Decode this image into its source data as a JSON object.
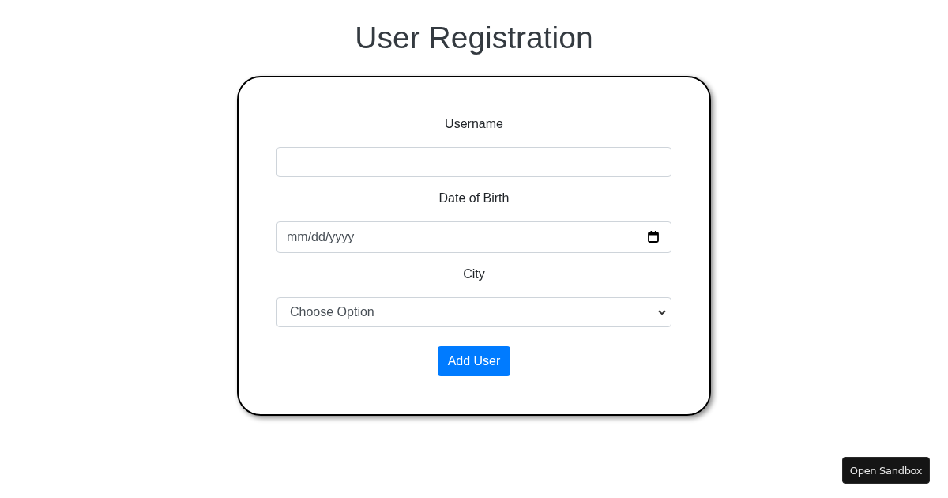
{
  "title": "User Registration",
  "form": {
    "fields": [
      {
        "kind": "text",
        "label": "Username"
      },
      {
        "kind": "date",
        "label": "Date of Birth",
        "placeholder": "mm/dd/yyyy"
      },
      {
        "kind": "select",
        "label": "City",
        "value": "Choose Option"
      }
    ],
    "submit_button": "Add User"
  },
  "sandbox_button": "Open Sandbox"
}
